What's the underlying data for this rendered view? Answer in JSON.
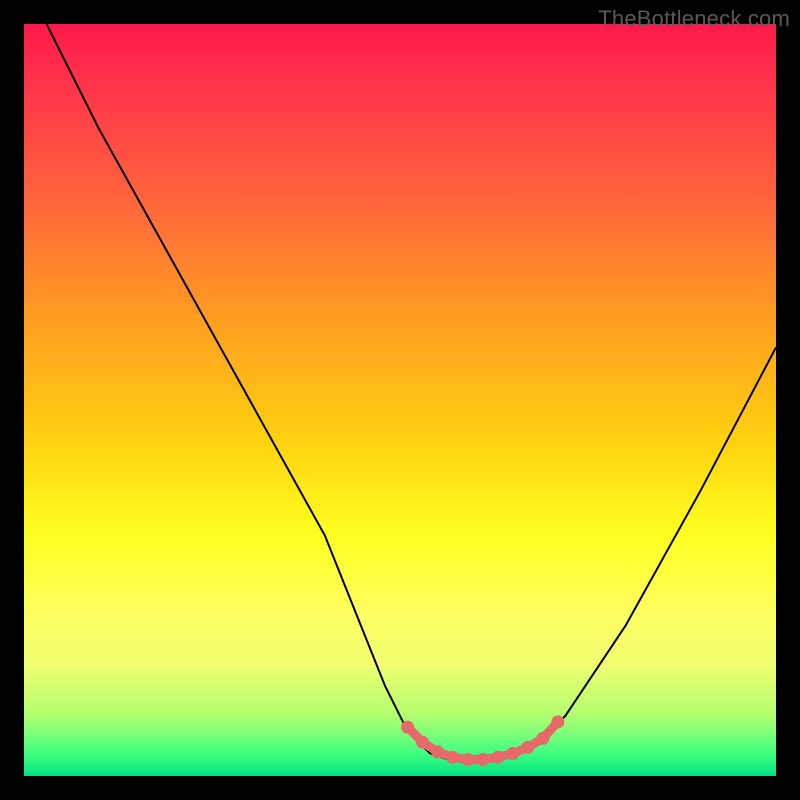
{
  "watermark": "TheBottleneck.com",
  "chart_data": {
    "type": "line",
    "title": "",
    "xlabel": "",
    "ylabel": "",
    "xlim": [
      0,
      100
    ],
    "ylim": [
      0,
      100
    ],
    "series": [
      {
        "name": "bottleneck-curve",
        "x": [
          3,
          10,
          20,
          30,
          40,
          48,
          51,
          54,
          57,
          60,
          63,
          66,
          69,
          72,
          80,
          90,
          100
        ],
        "y": [
          100,
          86,
          68,
          50,
          32,
          12,
          6,
          3,
          2,
          2,
          2,
          3,
          5,
          8,
          20,
          38,
          57
        ]
      }
    ],
    "markers": {
      "name": "highlight-points",
      "color": "#e66a6a",
      "x": [
        51,
        53,
        55,
        57,
        59,
        61,
        63,
        65,
        67,
        69,
        71
      ],
      "y": [
        6.5,
        4.5,
        3.2,
        2.5,
        2.2,
        2.2,
        2.5,
        3.0,
        3.8,
        5.0,
        7.2
      ]
    },
    "gradient_stops": [
      {
        "pos": 0,
        "color": "#ff1a4a"
      },
      {
        "pos": 25,
        "color": "#ff6a3a"
      },
      {
        "pos": 55,
        "color": "#ffd010"
      },
      {
        "pos": 78,
        "color": "#ffff60"
      },
      {
        "pos": 100,
        "color": "#00e080"
      }
    ]
  }
}
